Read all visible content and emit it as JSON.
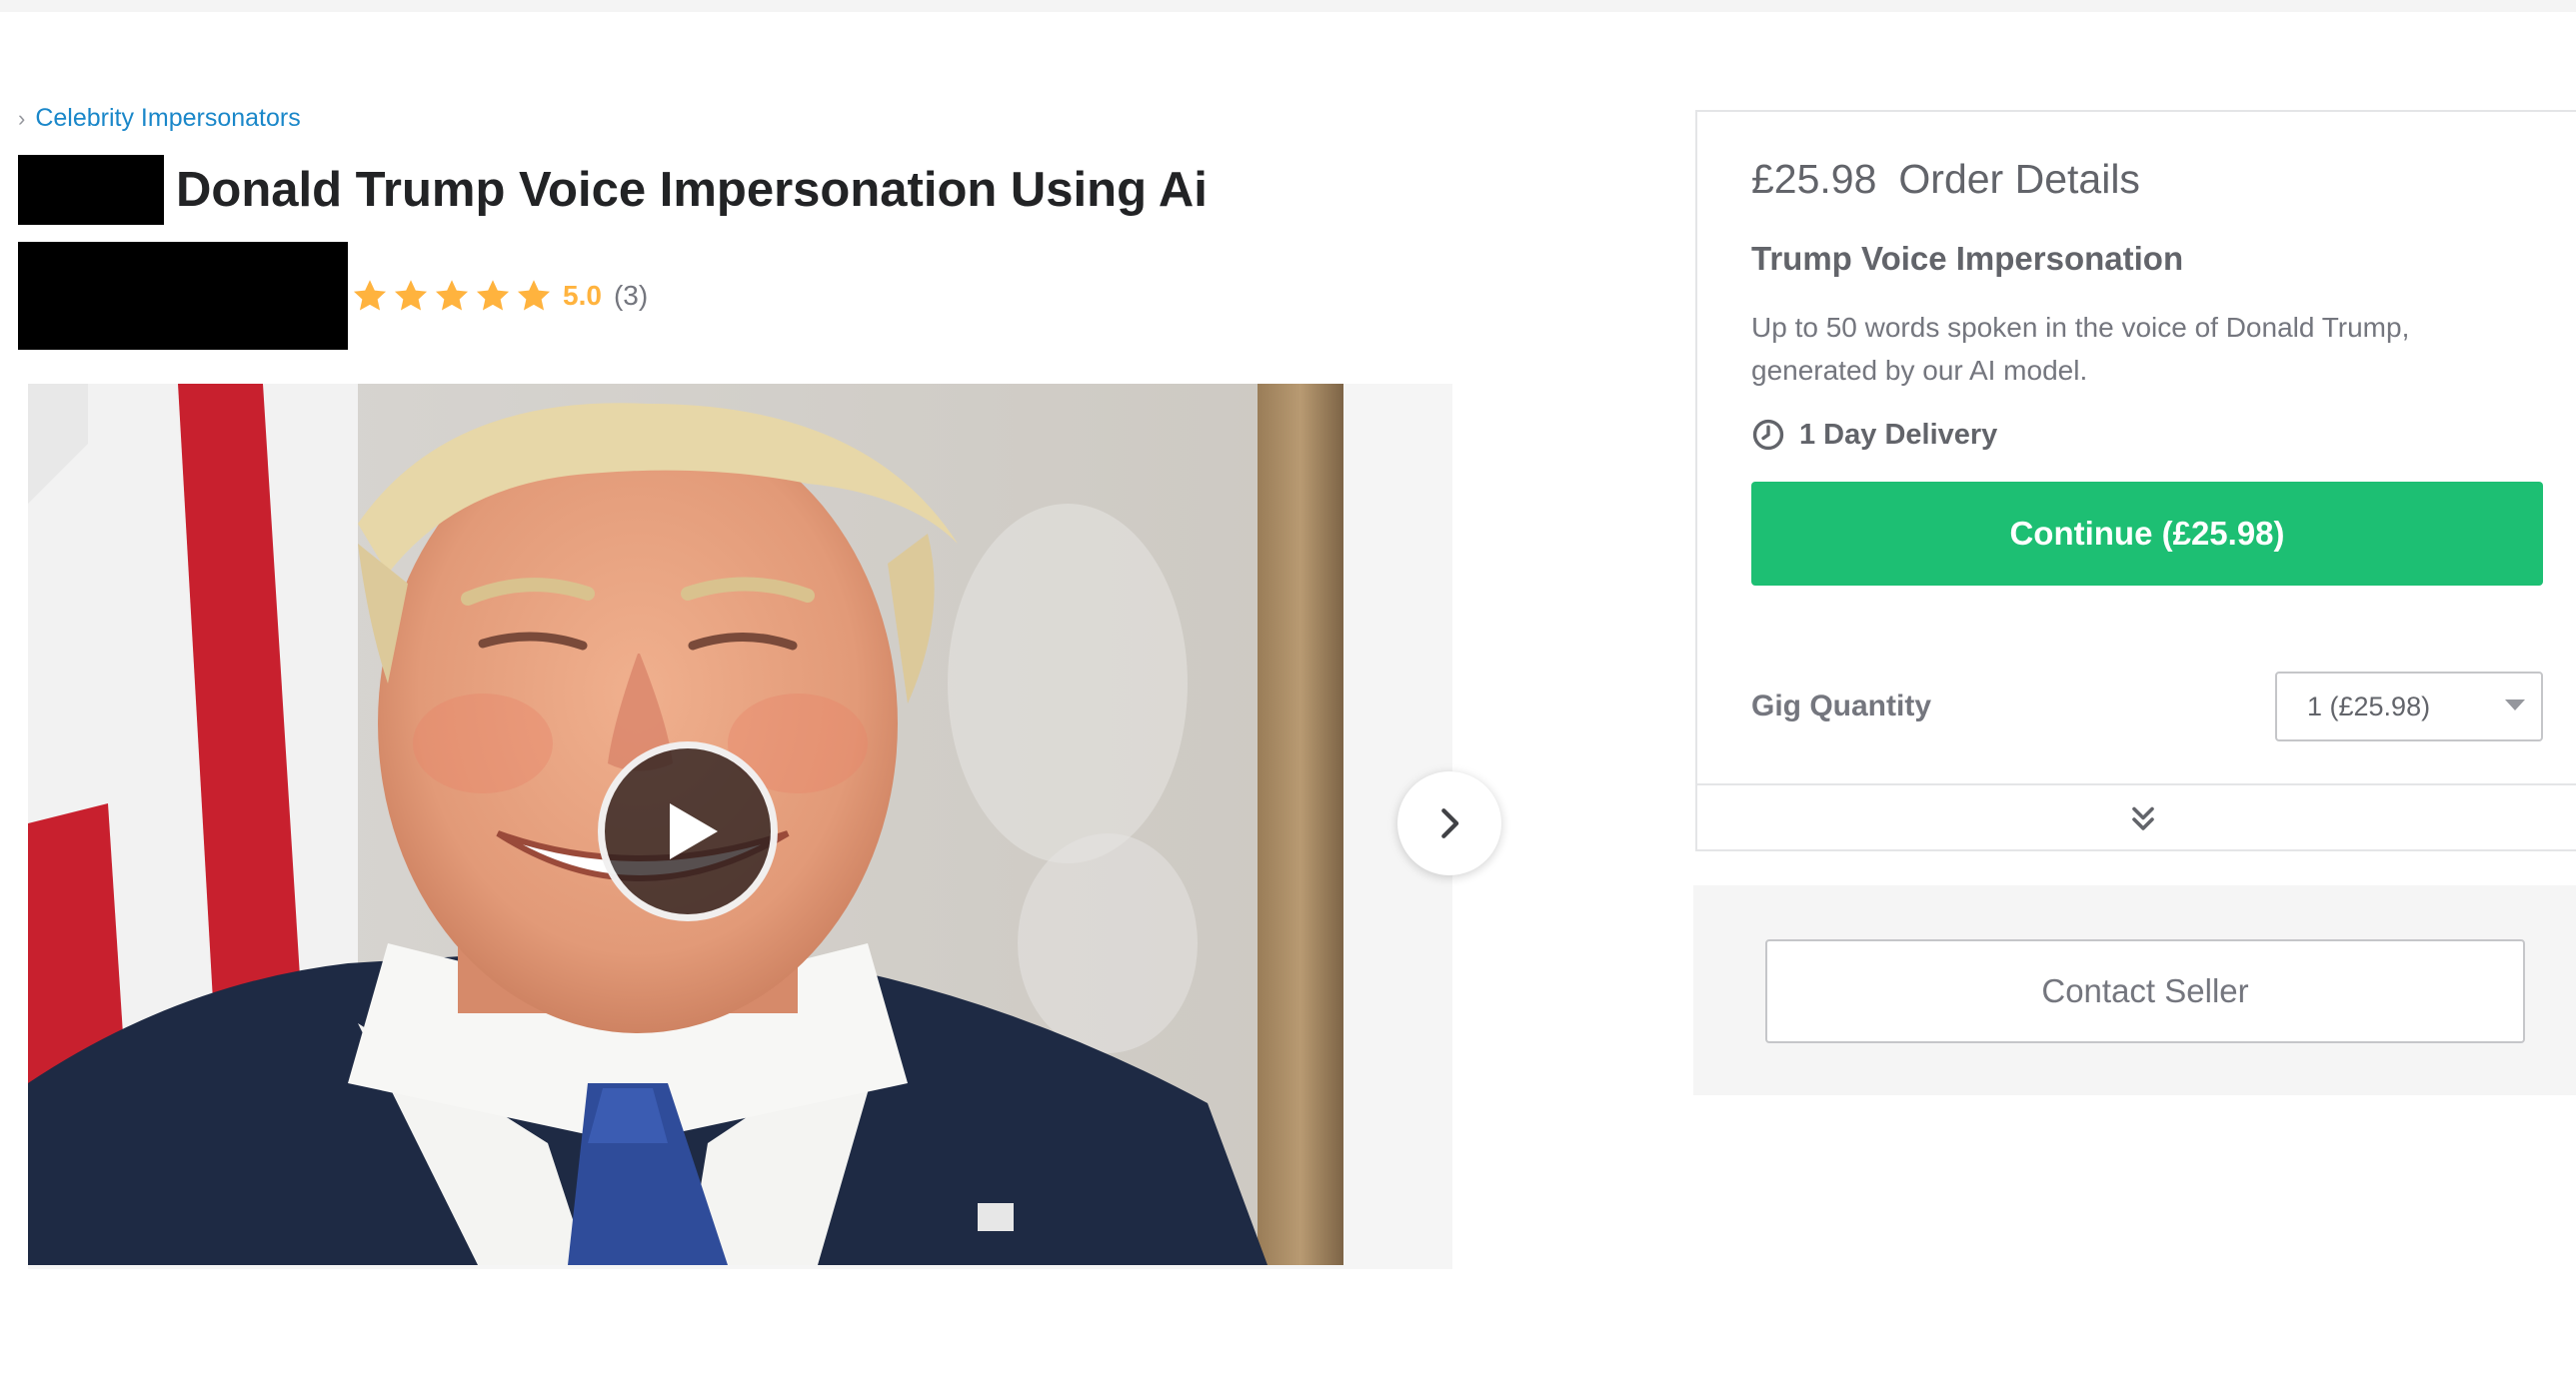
{
  "breadcrumb": {
    "category": "Celebrity Impersonators"
  },
  "gig": {
    "title": "Donald Trump Voice Impersonation Using Ai",
    "rating": "5.0",
    "rating_count": "(3)",
    "star_count": 5
  },
  "order": {
    "price": "£25.98",
    "heading": "Order Details",
    "package_title": "Trump Voice Impersonation",
    "package_description": "Up to 50 words spoken in the voice of Donald Trump, generated by our AI model.",
    "delivery": "1 Day Delivery",
    "continue_label": "Continue (£25.98)",
    "quantity_label": "Gig Quantity",
    "quantity_value": "1 (£25.98)"
  },
  "contact": {
    "label": "Contact Seller"
  },
  "colors": {
    "accent_green": "#1dbf73",
    "star_yellow": "#ffb33e",
    "link_blue": "#1a87c9"
  },
  "icons": {
    "breadcrumb": "chevron-right-icon",
    "star": "star-icon",
    "play": "play-icon",
    "next": "chevron-right-icon",
    "delivery": "clock-icon",
    "expand": "double-chevron-down-icon",
    "select": "caret-down-icon"
  }
}
